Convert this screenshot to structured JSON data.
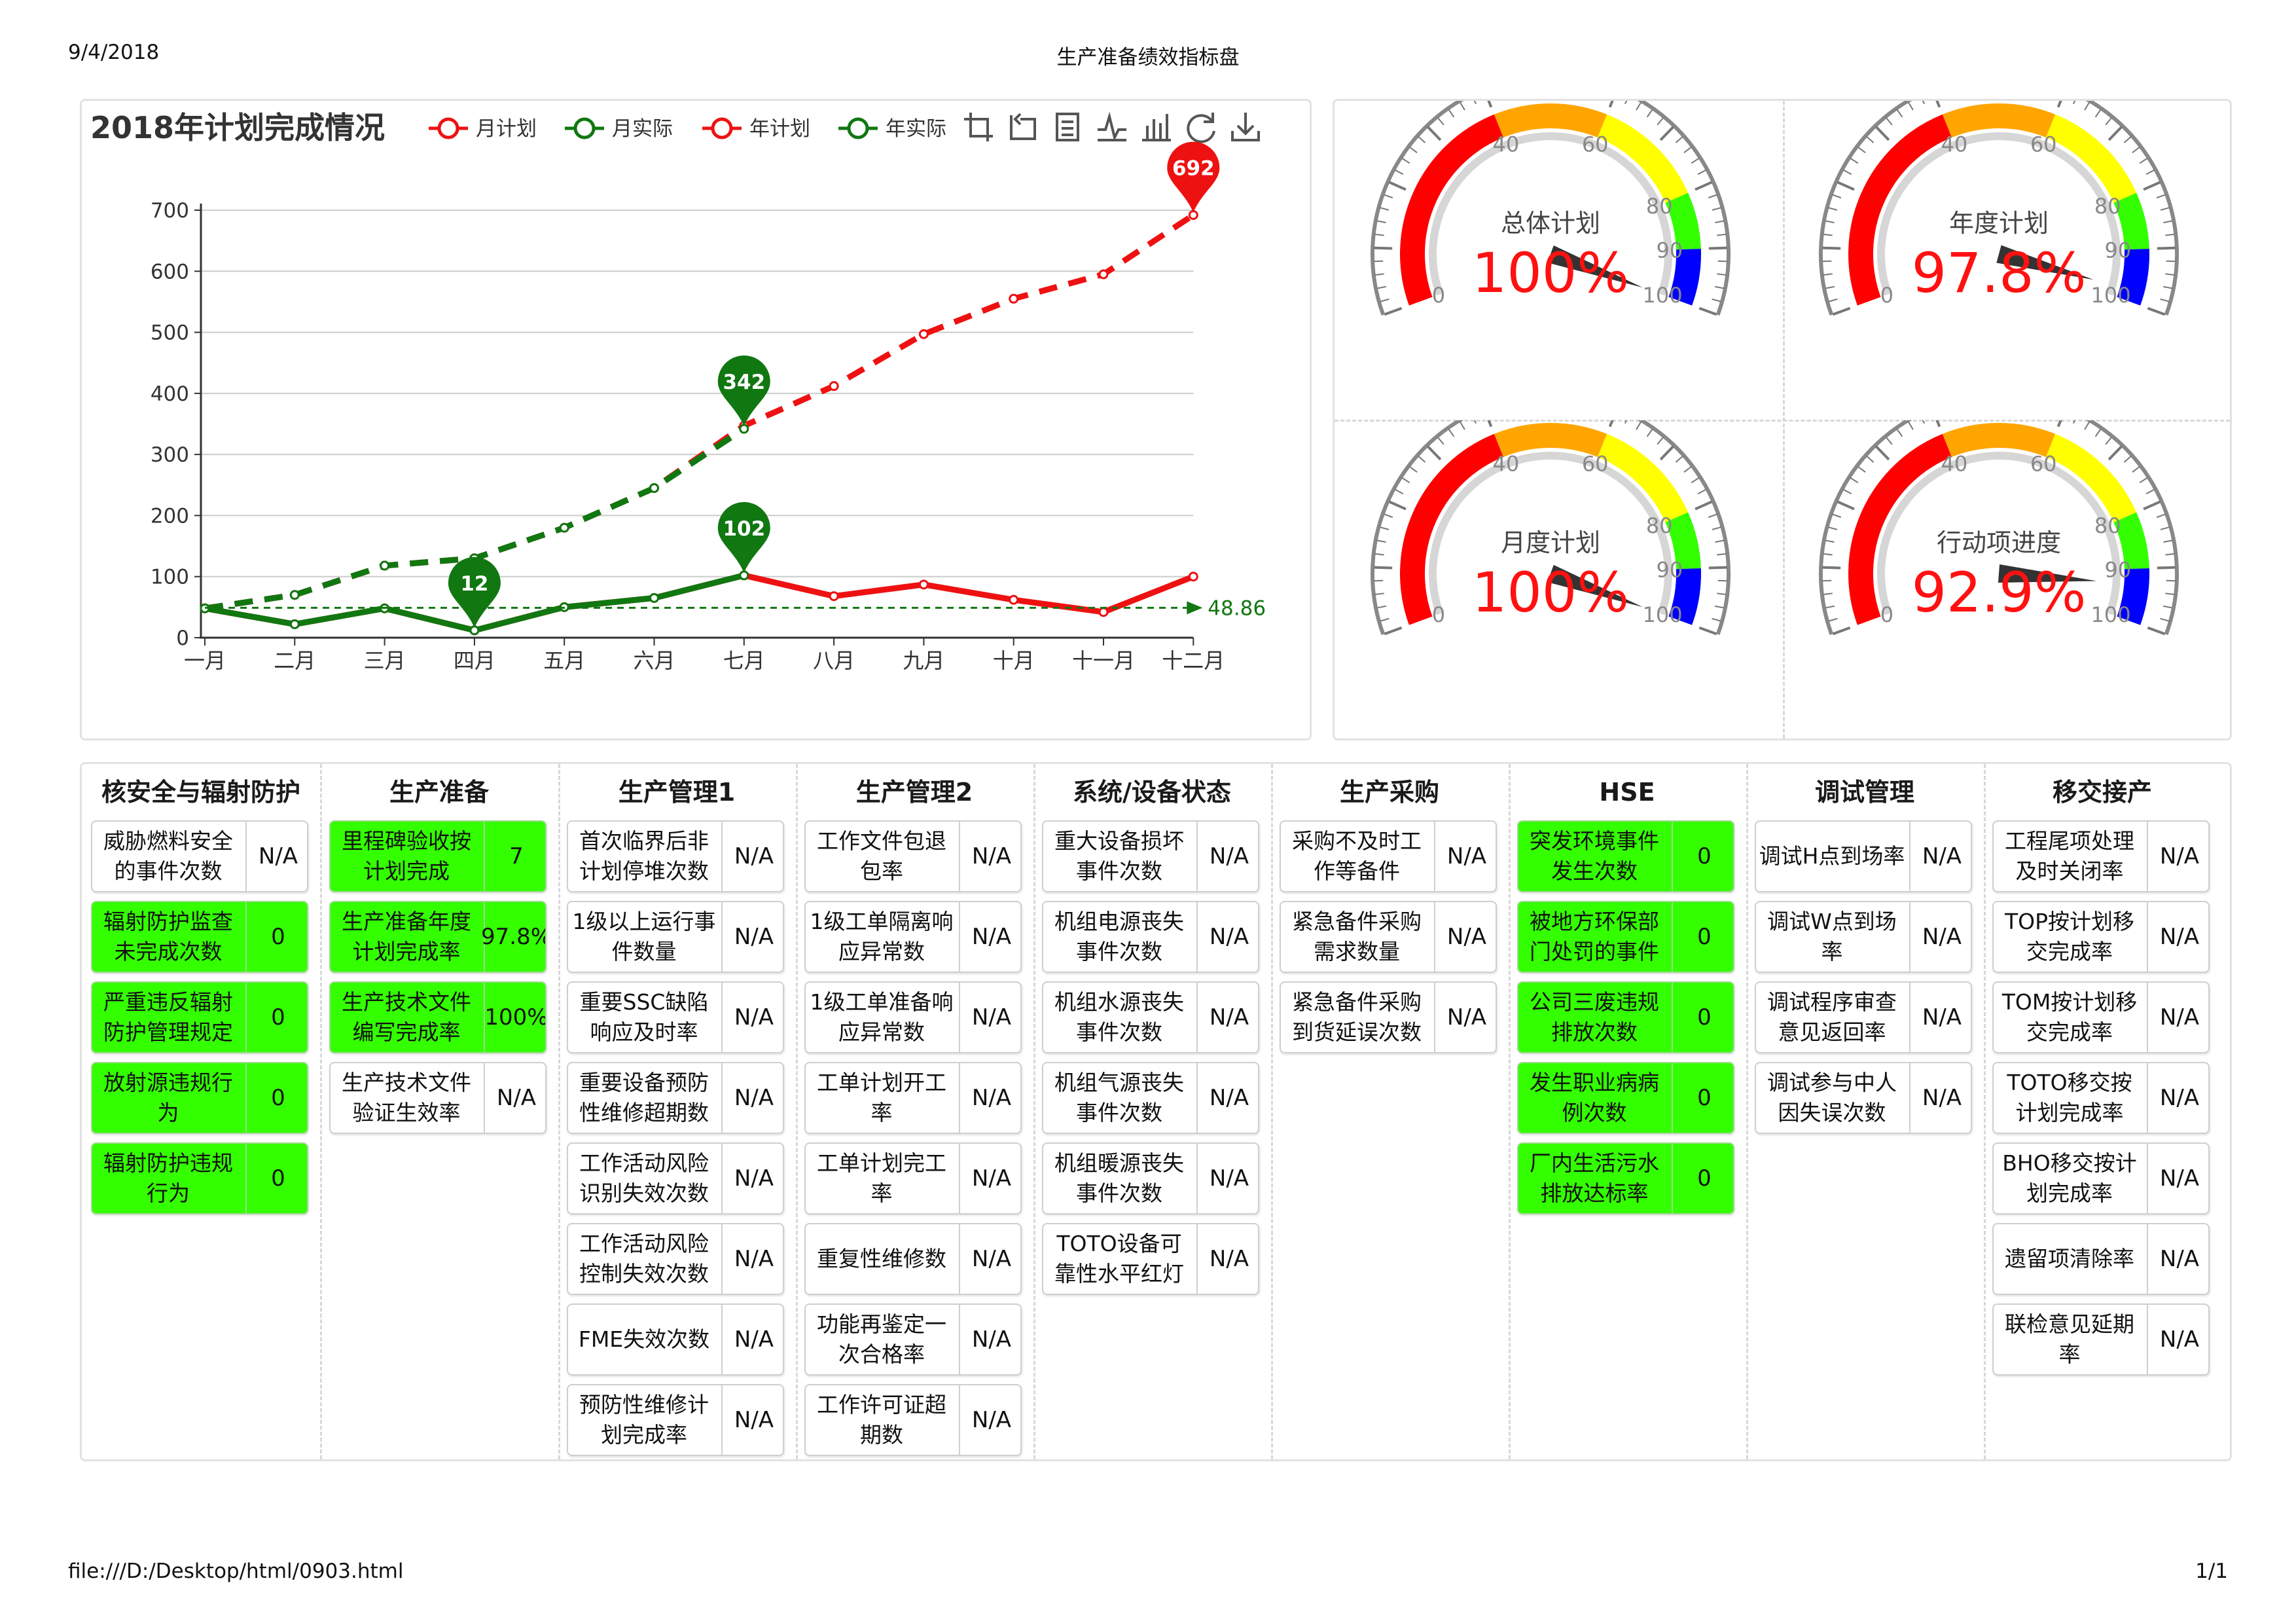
{
  "print_header": {
    "date": "9/4/2018",
    "title": "生产准备绩效指标盘",
    "url": "file:///D:/Desktop/html/0903.html",
    "page": "1/1"
  },
  "toolbox_icons": [
    "crop-icon",
    "undo-icon",
    "data-view-icon",
    "line-chart-icon",
    "bar-chart-icon",
    "refresh-icon",
    "download-icon"
  ],
  "colors": {
    "plan": "#ee1111",
    "actual": "#117711",
    "marker_text": "#ffffff",
    "gauge_red": "#ff0000",
    "gauge_orange": "#ffa500",
    "gauge_yellow": "#ffff00",
    "gauge_green": "#33ff00",
    "gauge_blue": "#0000ff",
    "kpi_green": "#33ff00"
  },
  "chart_data": {
    "type": "line",
    "title": "2018年计划完成情况",
    "categories": [
      "一月",
      "二月",
      "三月",
      "四月",
      "五月",
      "六月",
      "七月",
      "八月",
      "九月",
      "十月",
      "十一月",
      "十二月"
    ],
    "ylim": [
      0,
      700
    ],
    "yticks": [
      0,
      100,
      200,
      300,
      400,
      500,
      600,
      700
    ],
    "grid": true,
    "legend_position": "top",
    "series": [
      {
        "name": "月计划",
        "color": "#ee1111",
        "style": "solid",
        "values": [
          48,
          22,
          48,
          12,
          50,
          65,
          102,
          68,
          87,
          62,
          42,
          100
        ]
      },
      {
        "name": "月实际",
        "color": "#117711",
        "style": "solid",
        "values": [
          48,
          22,
          48,
          12,
          50,
          65,
          102,
          null,
          null,
          null,
          null,
          null
        ]
      },
      {
        "name": "年计划",
        "color": "#ee1111",
        "style": "dashed",
        "values": [
          48,
          70,
          118,
          130,
          180,
          245,
          347,
          412,
          497,
          555,
          595,
          692
        ]
      },
      {
        "name": "年实际",
        "color": "#117711",
        "style": "dashed",
        "values": [
          48,
          70,
          118,
          130,
          180,
          245,
          342,
          null,
          null,
          null,
          null,
          null
        ]
      }
    ],
    "markers": [
      {
        "label": "692",
        "x": "十二月",
        "y": 692,
        "color": "#ee1111"
      },
      {
        "label": "342",
        "x": "七月",
        "y": 342,
        "color": "#117711"
      },
      {
        "label": "102",
        "x": "七月",
        "y": 102,
        "color": "#117711"
      },
      {
        "label": "12",
        "x": "四月",
        "y": 12,
        "color": "#117711"
      }
    ],
    "average_line": {
      "value": 48.86,
      "label": "48.86",
      "color": "#117711"
    }
  },
  "gauges": [
    {
      "title": "总体计划",
      "value": 100,
      "display": "100%"
    },
    {
      "title": "年度计划",
      "value": 97.8,
      "display": "97.8%"
    },
    {
      "title": "月度计划",
      "value": 100,
      "display": "100%"
    },
    {
      "title": "行动项进度",
      "value": 92.9,
      "display": "92.9%"
    }
  ],
  "gauge_scale": {
    "min": 0,
    "max": 100,
    "labels": [
      "0",
      "40",
      "60",
      "80",
      "90",
      "100"
    ]
  },
  "kpi_columns": [
    {
      "title": "核安全与辐射防护",
      "items": [
        {
          "label": "威胁燃料安全的事件次数",
          "value": "N/A",
          "green": false
        },
        {
          "label": "辐射防护监查未完成次数",
          "value": "0",
          "green": true
        },
        {
          "label": "严重违反辐射防护管理规定",
          "value": "0",
          "green": true
        },
        {
          "label": "放射源违规行为",
          "value": "0",
          "green": true
        },
        {
          "label": "辐射防护违规行为",
          "value": "0",
          "green": true
        }
      ]
    },
    {
      "title": "生产准备",
      "items": [
        {
          "label": "里程碑验收按计划完成",
          "value": "7",
          "green": true
        },
        {
          "label": "生产准备年度计划完成率",
          "value": "97.8%",
          "green": true
        },
        {
          "label": "生产技术文件编写完成率",
          "value": "100%",
          "green": true
        },
        {
          "label": "生产技术文件验证生效率",
          "value": "N/A",
          "green": false
        }
      ]
    },
    {
      "title": "生产管理1",
      "items": [
        {
          "label": "首次临界后非计划停堆次数",
          "value": "N/A",
          "green": false
        },
        {
          "label": "1级以上运行事件数量",
          "value": "N/A",
          "green": false
        },
        {
          "label": "重要SSC缺陷响应及时率",
          "value": "N/A",
          "green": false
        },
        {
          "label": "重要设备预防性维修超期数",
          "value": "N/A",
          "green": false
        },
        {
          "label": "工作活动风险识别失效次数",
          "value": "N/A",
          "green": false
        },
        {
          "label": "工作活动风险控制失效次数",
          "value": "N/A",
          "green": false
        },
        {
          "label": "FME失效次数",
          "value": "N/A",
          "green": false
        },
        {
          "label": "预防性维修计划完成率",
          "value": "N/A",
          "green": false
        }
      ]
    },
    {
      "title": "生产管理2",
      "items": [
        {
          "label": "工作文件包退包率",
          "value": "N/A",
          "green": false
        },
        {
          "label": "1级工单隔离响应异常数",
          "value": "N/A",
          "green": false
        },
        {
          "label": "1级工单准备响应异常数",
          "value": "N/A",
          "green": false
        },
        {
          "label": "工单计划开工率",
          "value": "N/A",
          "green": false
        },
        {
          "label": "工单计划完工率",
          "value": "N/A",
          "green": false
        },
        {
          "label": "重复性维修数",
          "value": "N/A",
          "green": false
        },
        {
          "label": "功能再鉴定一次合格率",
          "value": "N/A",
          "green": false
        },
        {
          "label": "工作许可证超期数",
          "value": "N/A",
          "green": false
        }
      ]
    },
    {
      "title": "系统/设备状态",
      "items": [
        {
          "label": "重大设备损坏事件次数",
          "value": "N/A",
          "green": false
        },
        {
          "label": "机组电源丧失事件次数",
          "value": "N/A",
          "green": false
        },
        {
          "label": "机组水源丧失事件次数",
          "value": "N/A",
          "green": false
        },
        {
          "label": "机组气源丧失事件次数",
          "value": "N/A",
          "green": false
        },
        {
          "label": "机组暖源丧失事件次数",
          "value": "N/A",
          "green": false
        },
        {
          "label": "TOTO设备可靠性水平红灯",
          "value": "N/A",
          "green": false
        }
      ]
    },
    {
      "title": "生产采购",
      "items": [
        {
          "label": "采购不及时工作等备件",
          "value": "N/A",
          "green": false
        },
        {
          "label": "紧急备件采购需求数量",
          "value": "N/A",
          "green": false
        },
        {
          "label": "紧急备件采购到货延误次数",
          "value": "N/A",
          "green": false
        }
      ]
    },
    {
      "title": "HSE",
      "items": [
        {
          "label": "突发环境事件发生次数",
          "value": "0",
          "green": true
        },
        {
          "label": "被地方环保部门处罚的事件",
          "value": "0",
          "green": true
        },
        {
          "label": "公司三废违规排放次数",
          "value": "0",
          "green": true
        },
        {
          "label": "发生职业病病例次数",
          "value": "0",
          "green": true
        },
        {
          "label": "厂内生活污水排放达标率",
          "value": "0",
          "green": true
        }
      ]
    },
    {
      "title": "调试管理",
      "items": [
        {
          "label": "调试H点到场率",
          "value": "N/A",
          "green": false
        },
        {
          "label": "调试W点到场率",
          "value": "N/A",
          "green": false
        },
        {
          "label": "调试程序审查意见返回率",
          "value": "N/A",
          "green": false
        },
        {
          "label": "调试参与中人因失误次数",
          "value": "N/A",
          "green": false
        }
      ]
    },
    {
      "title": "移交接产",
      "items": [
        {
          "label": "工程尾项处理及时关闭率",
          "value": "N/A",
          "green": false
        },
        {
          "label": "TOP按计划移交完成率",
          "value": "N/A",
          "green": false
        },
        {
          "label": "TOM按计划移交完成率",
          "value": "N/A",
          "green": false
        },
        {
          "label": "TOTO移交按计划完成率",
          "value": "N/A",
          "green": false
        },
        {
          "label": "BHO移交按计划完成率",
          "value": "N/A",
          "green": false
        },
        {
          "label": "遗留项清除率",
          "value": "N/A",
          "green": false
        },
        {
          "label": "联检意见延期率",
          "value": "N/A",
          "green": false
        }
      ]
    }
  ]
}
